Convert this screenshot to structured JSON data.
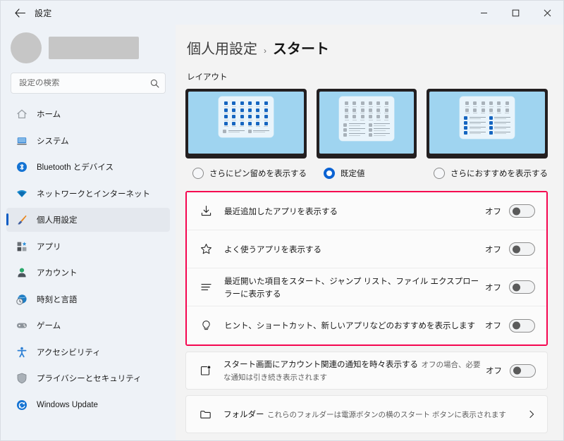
{
  "window": {
    "title": "設定",
    "back_icon": "arrow-left-icon",
    "controls": [
      {
        "name": "minimize-button",
        "glyph": "minimize-icon"
      },
      {
        "name": "maximize-button",
        "glyph": "maximize-icon"
      },
      {
        "name": "close-button",
        "glyph": "close-icon"
      }
    ]
  },
  "sidebar": {
    "search": {
      "value": "",
      "placeholder": "設定の検索",
      "icon": "search-icon"
    },
    "items": [
      {
        "label": "ホーム",
        "icon": "home-icon",
        "active": false
      },
      {
        "label": "システム",
        "icon": "system-icon",
        "active": false
      },
      {
        "label": "Bluetooth とデバイス",
        "icon": "bluetooth-icon",
        "active": false
      },
      {
        "label": "ネットワークとインターネット",
        "icon": "wifi-icon",
        "active": false
      },
      {
        "label": "個人用設定",
        "icon": "paintbrush-icon",
        "active": true
      },
      {
        "label": "アプリ",
        "icon": "apps-icon",
        "active": false
      },
      {
        "label": "アカウント",
        "icon": "account-icon",
        "active": false
      },
      {
        "label": "時刻と言語",
        "icon": "clock-globe-icon",
        "active": false
      },
      {
        "label": "ゲーム",
        "icon": "gamepad-icon",
        "active": false
      },
      {
        "label": "アクセシビリティ",
        "icon": "accessibility-icon",
        "active": false
      },
      {
        "label": "プライバシーとセキュリティ",
        "icon": "shield-icon",
        "active": false
      },
      {
        "label": "Windows Update",
        "icon": "update-icon",
        "active": false
      }
    ]
  },
  "header": {
    "parent": "個人用設定",
    "separator": "›",
    "current": "スタート"
  },
  "layout_section": {
    "label": "レイアウト",
    "options": [
      {
        "label": "さらにピン留めを表示する",
        "selected": false,
        "grid_rows": 4,
        "grid_color": "blue",
        "rec_rows": 1,
        "rec_color": "gray"
      },
      {
        "label": "既定値",
        "selected": true,
        "grid_rows": 3,
        "grid_color": "gray",
        "rec_rows": 3,
        "rec_color": "gray"
      },
      {
        "label": "さらにおすすめを表示する",
        "selected": false,
        "grid_rows": 2,
        "grid_color": "gray",
        "rec_rows": 4,
        "rec_color": "blue"
      }
    ]
  },
  "highlight": {
    "color": "#f5054f"
  },
  "highlighted_rows": [
    {
      "icon": "download-icon",
      "title": "最近追加したアプリを表示する",
      "subtitle": "",
      "toggle_state": "オフ",
      "toggle_on": false
    },
    {
      "icon": "star-icon",
      "title": "よく使うアプリを表示する",
      "subtitle": "",
      "toggle_state": "オフ",
      "toggle_on": false
    },
    {
      "icon": "list-icon",
      "title": "最近開いた項目をスタート、ジャンプ リスト、ファイル エクスプローラーに表示する",
      "subtitle": "",
      "toggle_state": "オフ",
      "toggle_on": false
    },
    {
      "icon": "lightbulb-icon",
      "title": "ヒント、ショートカット、新しいアプリなどのおすすめを表示します",
      "subtitle": "",
      "toggle_state": "オフ",
      "toggle_on": false
    }
  ],
  "other_rows": [
    {
      "icon": "notification-badge-icon",
      "title": "スタート画面にアカウント関連の通知を時々表示する",
      "subtitle": "オフの場合、必要な通知は引き続き表示されます",
      "toggle_state": "オフ",
      "toggle_on": false,
      "kind": "toggle"
    },
    {
      "icon": "folder-icon",
      "title": "フォルダー",
      "subtitle": "これらのフォルダーは電源ボタンの横のスタート ボタンに表示されます",
      "toggle_state": "",
      "kind": "chevron",
      "chevron": "chevron-right-icon"
    }
  ]
}
